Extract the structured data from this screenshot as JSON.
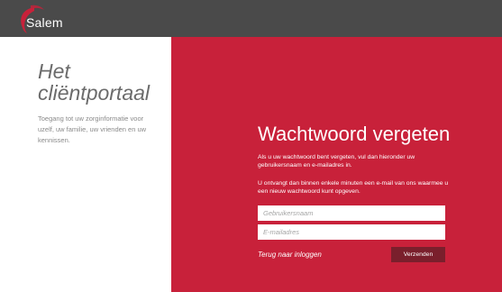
{
  "header": {
    "brand_name": "Salem",
    "background_color": "#4a4a4a",
    "logo_icon": "swoosh-logo-icon"
  },
  "intro": {
    "title_line1": "Het",
    "title_line2": "cliëntportaal",
    "description": "Toegang tot uw zorginformatie voor uzelf, uw familie, uw vrienden en uw kennissen."
  },
  "form": {
    "title": "Wachtwoord vergeten",
    "instruction": "Als u uw wachtwoord bent vergeten, vul dan hieronder uw gebruikersnaam en e-mailadres in.",
    "info": "U ontvangt dan binnen enkele minuten een e-mail van ons waarmee u een nieuw wachtwoord kunt opgeven.",
    "username_placeholder": "Gebruikersnaam",
    "email_placeholder": "E-mailadres",
    "back_link": "Terug naar inloggen",
    "submit_label": "Verzenden"
  },
  "colors": {
    "accent": "#c8213a",
    "button": "#7a1f2c",
    "intro_text": "#6b6b6b"
  }
}
